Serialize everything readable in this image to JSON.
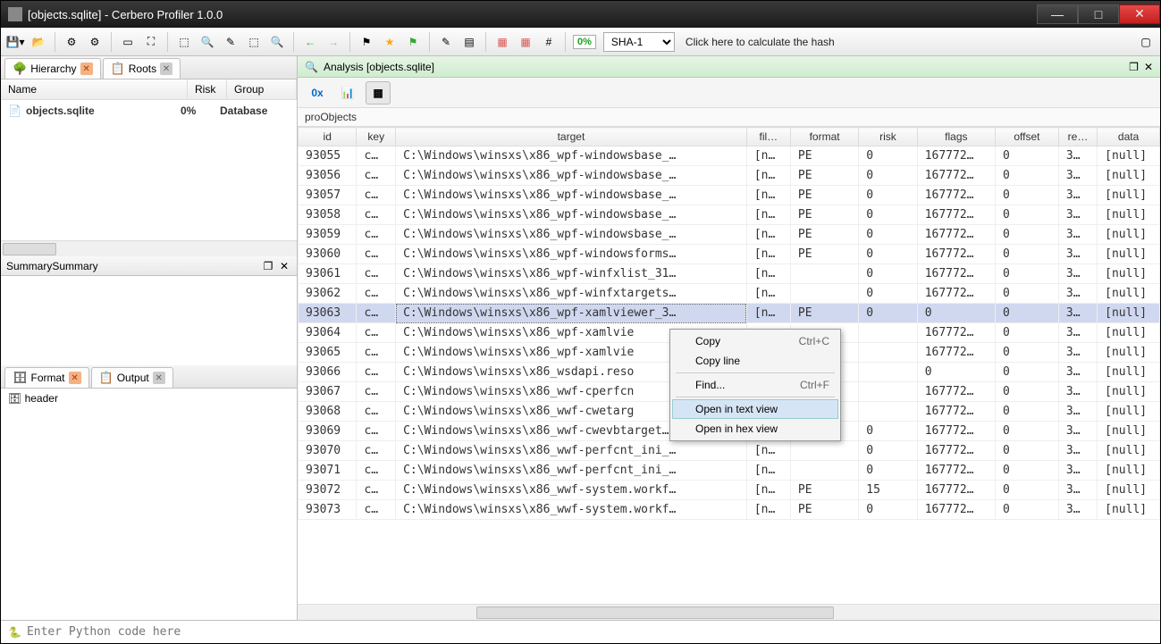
{
  "window": {
    "title": "[objects.sqlite] - Cerbero Profiler 1.0.0"
  },
  "toolbar": {
    "pct": "0%",
    "hash_algo": "SHA-1",
    "hash_link": "Click here to calculate the hash"
  },
  "left_tabs": {
    "hierarchy": "Hierarchy",
    "roots": "Roots"
  },
  "tree": {
    "headers": {
      "name": "Name",
      "risk": "Risk",
      "group": "Group"
    },
    "row": {
      "name": "objects.sqlite",
      "risk": "0%",
      "group": "Database"
    }
  },
  "summary_pane": {
    "title": "Summary"
  },
  "format_tabs": {
    "format": "Format",
    "output": "Output"
  },
  "format_tree": {
    "root": "header"
  },
  "analysis": {
    "label": "Analysis [objects.sqlite]"
  },
  "viewbar": {
    "hex": "0x"
  },
  "table": {
    "name": "proObjects",
    "headers": [
      "id",
      "key",
      "target",
      "fil…",
      "format",
      "risk",
      "flags",
      "offset",
      "re…",
      "data"
    ],
    "selected_index": 8,
    "rows": [
      {
        "id": "93055",
        "key": "c…",
        "target": "C:\\Windows\\winsxs\\x86_wpf-windowsbase_…",
        "fil": "[n…",
        "format": "PE",
        "risk": "0",
        "flags": "167772…",
        "offset": "0",
        "re": "3…",
        "data": "[null]"
      },
      {
        "id": "93056",
        "key": "c…",
        "target": "C:\\Windows\\winsxs\\x86_wpf-windowsbase_…",
        "fil": "[n…",
        "format": "PE",
        "risk": "0",
        "flags": "167772…",
        "offset": "0",
        "re": "3…",
        "data": "[null]"
      },
      {
        "id": "93057",
        "key": "c…",
        "target": "C:\\Windows\\winsxs\\x86_wpf-windowsbase_…",
        "fil": "[n…",
        "format": "PE",
        "risk": "0",
        "flags": "167772…",
        "offset": "0",
        "re": "3…",
        "data": "[null]"
      },
      {
        "id": "93058",
        "key": "c…",
        "target": "C:\\Windows\\winsxs\\x86_wpf-windowsbase_…",
        "fil": "[n…",
        "format": "PE",
        "risk": "0",
        "flags": "167772…",
        "offset": "0",
        "re": "3…",
        "data": "[null]"
      },
      {
        "id": "93059",
        "key": "c…",
        "target": "C:\\Windows\\winsxs\\x86_wpf-windowsbase_…",
        "fil": "[n…",
        "format": "PE",
        "risk": "0",
        "flags": "167772…",
        "offset": "0",
        "re": "3…",
        "data": "[null]"
      },
      {
        "id": "93060",
        "key": "c…",
        "target": "C:\\Windows\\winsxs\\x86_wpf-windowsforms…",
        "fil": "[n…",
        "format": "PE",
        "risk": "0",
        "flags": "167772…",
        "offset": "0",
        "re": "3…",
        "data": "[null]"
      },
      {
        "id": "93061",
        "key": "c…",
        "target": "C:\\Windows\\winsxs\\x86_wpf-winfxlist_31…",
        "fil": "[n…",
        "format": "",
        "risk": "0",
        "flags": "167772…",
        "offset": "0",
        "re": "3…",
        "data": "[null]"
      },
      {
        "id": "93062",
        "key": "c…",
        "target": "C:\\Windows\\winsxs\\x86_wpf-winfxtargets…",
        "fil": "[n…",
        "format": "",
        "risk": "0",
        "flags": "167772…",
        "offset": "0",
        "re": "3…",
        "data": "[null]"
      },
      {
        "id": "93063",
        "key": "c…",
        "target": "C:\\Windows\\winsxs\\x86_wpf-xamlviewer_3…",
        "fil": "[n…",
        "format": "PE",
        "risk": "0",
        "flags": "0",
        "offset": "0",
        "re": "3…",
        "data": "[null]"
      },
      {
        "id": "93064",
        "key": "c…",
        "target": "C:\\Windows\\winsxs\\x86_wpf-xamlvie",
        "fil": "",
        "format": "",
        "risk": "",
        "flags": "167772…",
        "offset": "0",
        "re": "3…",
        "data": "[null]"
      },
      {
        "id": "93065",
        "key": "c…",
        "target": "C:\\Windows\\winsxs\\x86_wpf-xamlvie",
        "fil": "",
        "format": "",
        "risk": "",
        "flags": "167772…",
        "offset": "0",
        "re": "3…",
        "data": "[null]"
      },
      {
        "id": "93066",
        "key": "c…",
        "target": "C:\\Windows\\winsxs\\x86_wsdapi.reso",
        "fil": "",
        "format": "",
        "risk": "",
        "flags": "0",
        "offset": "0",
        "re": "3…",
        "data": "[null]"
      },
      {
        "id": "93067",
        "key": "c…",
        "target": "C:\\Windows\\winsxs\\x86_wwf-cperfcn",
        "fil": "",
        "format": "",
        "risk": "",
        "flags": "167772…",
        "offset": "0",
        "re": "3…",
        "data": "[null]"
      },
      {
        "id": "93068",
        "key": "c…",
        "target": "C:\\Windows\\winsxs\\x86_wwf-cwetarg",
        "fil": "",
        "format": "",
        "risk": "",
        "flags": "167772…",
        "offset": "0",
        "re": "3…",
        "data": "[null]"
      },
      {
        "id": "93069",
        "key": "c…",
        "target": "C:\\Windows\\winsxs\\x86_wwf-cwevbtarget…",
        "fil": "[n…",
        "format": "",
        "risk": "0",
        "flags": "167772…",
        "offset": "0",
        "re": "3…",
        "data": "[null]"
      },
      {
        "id": "93070",
        "key": "c…",
        "target": "C:\\Windows\\winsxs\\x86_wwf-perfcnt_ini_…",
        "fil": "[n…",
        "format": "",
        "risk": "0",
        "flags": "167772…",
        "offset": "0",
        "re": "3…",
        "data": "[null]"
      },
      {
        "id": "93071",
        "key": "c…",
        "target": "C:\\Windows\\winsxs\\x86_wwf-perfcnt_ini_…",
        "fil": "[n…",
        "format": "",
        "risk": "0",
        "flags": "167772…",
        "offset": "0",
        "re": "3…",
        "data": "[null]"
      },
      {
        "id": "93072",
        "key": "c…",
        "target": "C:\\Windows\\winsxs\\x86_wwf-system.workf…",
        "fil": "[n…",
        "format": "PE",
        "risk": "15",
        "flags": "167772…",
        "offset": "0",
        "re": "3…",
        "data": "[null]"
      },
      {
        "id": "93073",
        "key": "c…",
        "target": "C:\\Windows\\winsxs\\x86_wwf-system.workf…",
        "fil": "[n…",
        "format": "PE",
        "risk": "0",
        "flags": "167772…",
        "offset": "0",
        "re": "3…",
        "data": "[null]"
      }
    ]
  },
  "context_menu": {
    "items": [
      {
        "label": "Copy",
        "shortcut": "Ctrl+C"
      },
      {
        "label": "Copy line",
        "shortcut": ""
      },
      {
        "sep": true
      },
      {
        "label": "Find...",
        "shortcut": "Ctrl+F"
      },
      {
        "sep": true
      },
      {
        "label": "Open in text view",
        "shortcut": "",
        "hover": true
      },
      {
        "label": "Open in hex view",
        "shortcut": ""
      }
    ]
  },
  "bottombar": {
    "placeholder": "Enter Python code here"
  }
}
